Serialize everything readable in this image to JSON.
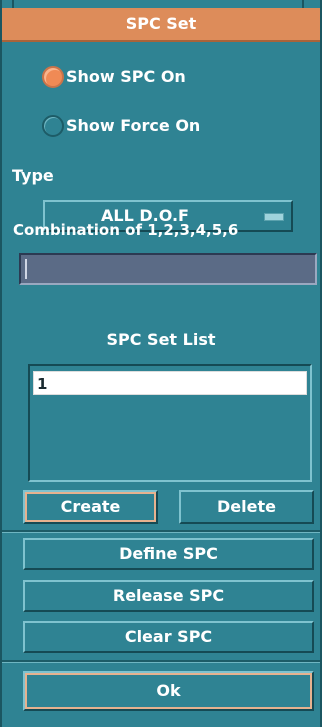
{
  "window": {
    "title": "SPC Set"
  },
  "display_options": [
    {
      "label": "Show SPC On",
      "selected": true
    },
    {
      "label": "Show Force On",
      "selected": false
    }
  ],
  "type": {
    "label": "Type",
    "selected_value": "ALL D.O.F"
  },
  "combination": {
    "label": "Combination of 1,2,3,4,5,6",
    "value": ""
  },
  "spc_set_list": {
    "heading": "SPC Set List",
    "items": [
      "1"
    ],
    "selected_index": 0
  },
  "actions": {
    "create": "Create",
    "delete": "Delete",
    "define": "Define SPC",
    "release": "Release SPC",
    "clear": "Clear SPC",
    "ok": "Ok"
  },
  "colors": {
    "title_bar": "#dd8c5a",
    "panel": "#2f8393",
    "radio_selected": "#f08a55",
    "entry_field": "#5b6b86"
  }
}
